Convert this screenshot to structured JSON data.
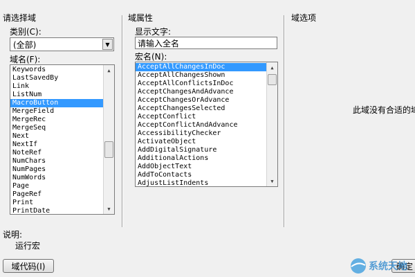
{
  "select_field": {
    "title": "请选择域",
    "category_label": "类别(C):",
    "category_value": "(全部)",
    "fieldname_label": "域名(F):",
    "field_names": [
      "Keywords",
      "LastSavedBy",
      "Link",
      "ListNum",
      "MacroButton",
      "MergeField",
      "MergeRec",
      "MergeSeq",
      "Next",
      "NextIf",
      "NoteRef",
      "NumChars",
      "NumPages",
      "NumWords",
      "Page",
      "PageRef",
      "Print",
      "PrintDate"
    ],
    "selected_index": 4
  },
  "field_properties": {
    "title": "域属性",
    "display_text_label": "显示文字:",
    "display_text_value": "请输入全名",
    "macro_name_label": "宏名(N):",
    "macro_names": [
      "AcceptAllChangesInDoc",
      "AcceptAllChangesShown",
      "AcceptAllConflictsInDoc",
      "AcceptChangesAndAdvance",
      "AcceptChangesOrAdvance",
      "AcceptChangesSelected",
      "AcceptConflict",
      "AcceptConflictAndAdvance",
      "AccessibilityChecker",
      "ActivateObject",
      "AddDigitalSignature",
      "AdditionalActions",
      "AddObjectText",
      "AddToContacts",
      "AdjustListIndents"
    ],
    "selected_index": 0
  },
  "field_options": {
    "title": "域选项",
    "message": "此域没有合适的域"
  },
  "description": {
    "label": "说明:",
    "text": "运行宏"
  },
  "buttons": {
    "field_codes": "域代码(I)",
    "ok": "确定"
  },
  "watermark": {
    "text": "系统天地"
  },
  "icons": {
    "dropdown": "chevron-down-icon",
    "scroll_up": "arrow-up-icon",
    "scroll_down": "arrow-down-icon"
  }
}
